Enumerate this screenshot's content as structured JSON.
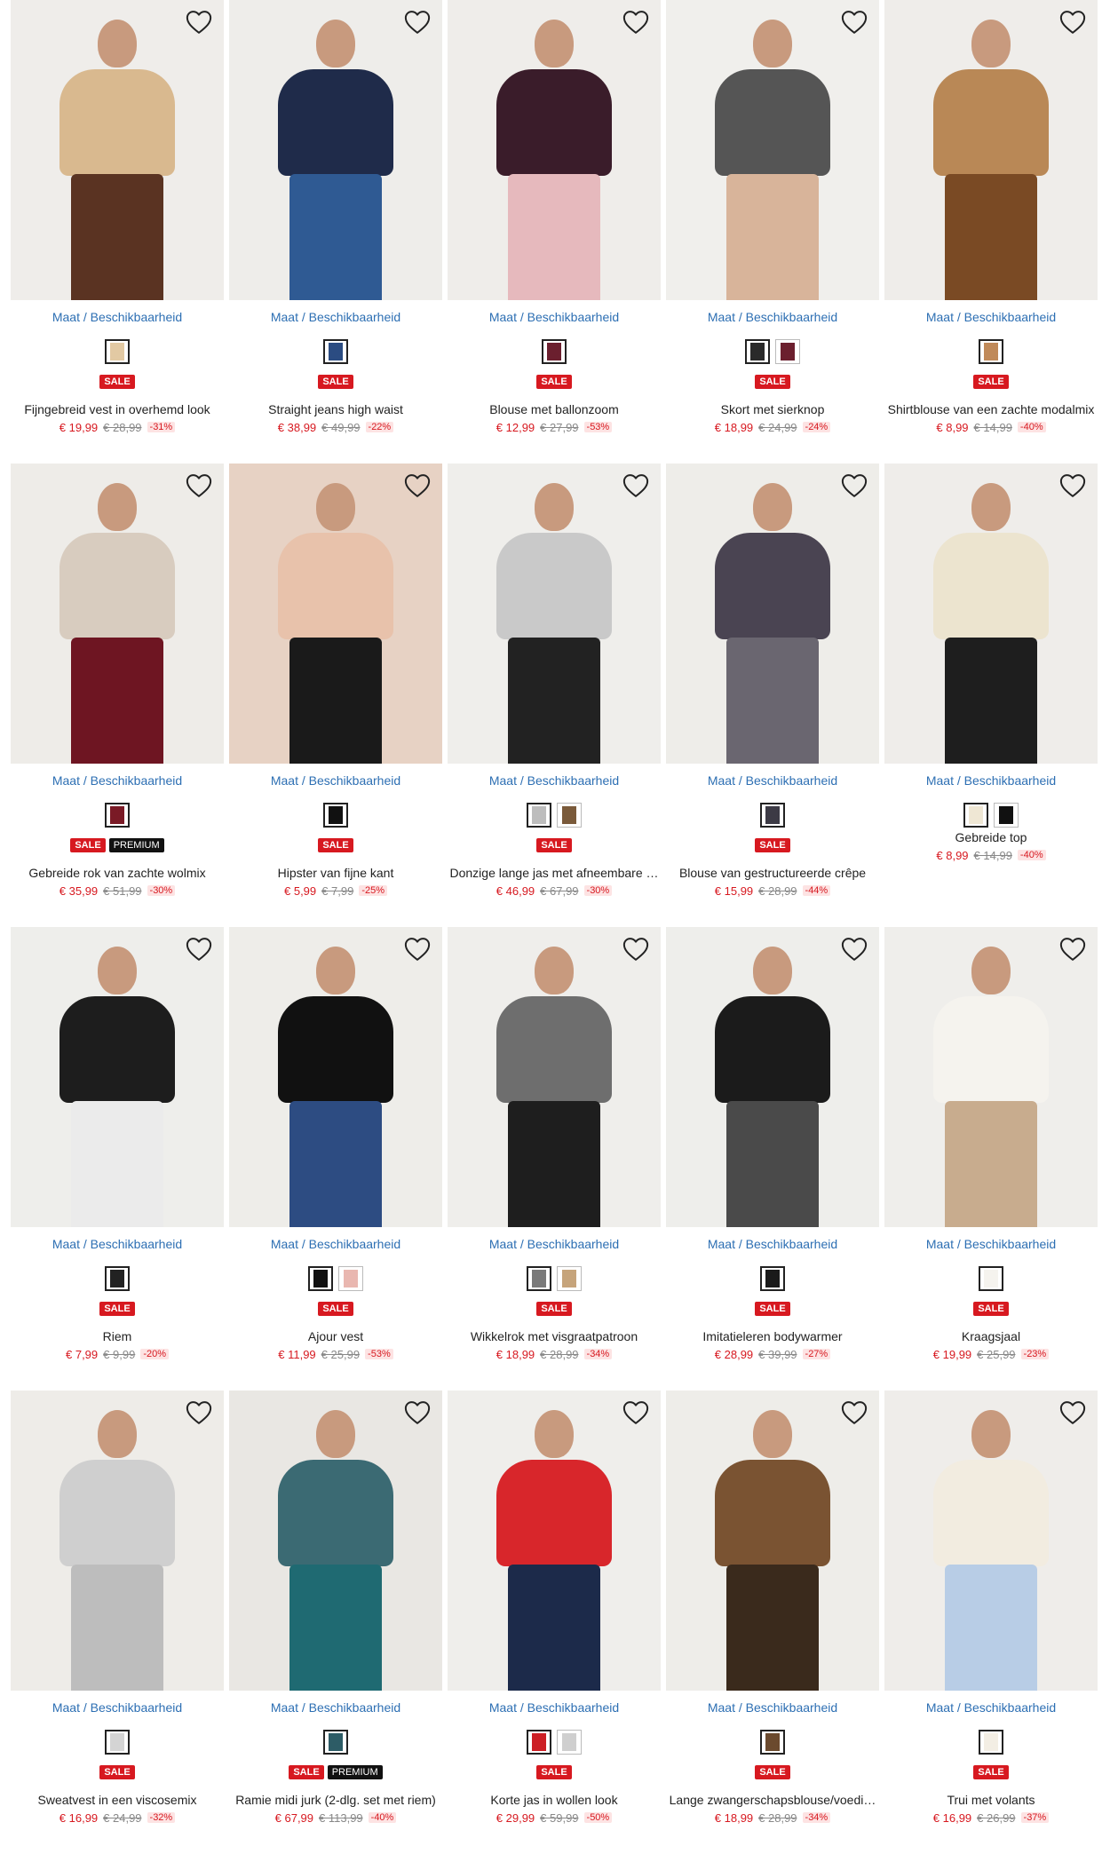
{
  "accent": "#d71920",
  "link_color": "#2d6fb3",
  "favorite_icon": "heart-outline-icon",
  "size_link_label": "Maat / Beschikbaarheid",
  "products": [
    {
      "name": "Fijngebreid vest in overhemd look",
      "price": "€ 19,99",
      "old_price": "€ 28,99",
      "discount": "-31%",
      "badges": [
        "SALE"
      ],
      "swatches": [
        "#e2c9a3"
      ],
      "image": {
        "bg": "#efedea",
        "top": "#d9b98f",
        "bottom": "#5a3322"
      }
    },
    {
      "name": "Straight jeans high waist",
      "price": "€ 38,99",
      "old_price": "€ 49,99",
      "discount": "-22%",
      "badges": [
        "SALE"
      ],
      "swatches": [
        "#2b4c82"
      ],
      "image": {
        "bg": "#eeedea",
        "top": "#1f2b4a",
        "bottom": "#2f5a93"
      }
    },
    {
      "name": "Blouse met ballonzoom",
      "price": "€ 12,99",
      "old_price": "€ 27,99",
      "discount": "-53%",
      "badges": [
        "SALE"
      ],
      "swatches": [
        "#6b1f2e"
      ],
      "image": {
        "bg": "#efedea",
        "top": "#3a1c2a",
        "bottom": "#e6b9bd"
      }
    },
    {
      "name": "Skort met sierknop",
      "price": "€ 18,99",
      "old_price": "€ 24,99",
      "discount": "-24%",
      "badges": [
        "SALE"
      ],
      "swatches": [
        "#2a2a2a",
        "#6b1f2e"
      ],
      "image": {
        "bg": "#f0efec",
        "top": "#555555",
        "bottom": "#d8b49a"
      }
    },
    {
      "name": "Shirtblouse van een zachte modalmix",
      "price": "€ 8,99",
      "old_price": "€ 14,99",
      "discount": "-40%",
      "badges": [
        "SALE"
      ],
      "swatches": [
        "#c08a5a"
      ],
      "image": {
        "bg": "#efedea",
        "top": "#b98856",
        "bottom": "#7a4a24"
      }
    },
    {
      "name": "Gebreide rok van zachte wolmix",
      "price": "€ 35,99",
      "old_price": "€ 51,99",
      "discount": "-30%",
      "badges": [
        "SALE",
        "PREMIUM"
      ],
      "swatches": [
        "#7a1a26"
      ],
      "image": {
        "bg": "#eeece8",
        "top": "#d8ccbf",
        "bottom": "#6e1522"
      }
    },
    {
      "name": "Hipster van fijne kant",
      "price": "€ 5,99",
      "old_price": "€ 7,99",
      "discount": "-25%",
      "badges": [
        "SALE"
      ],
      "swatches": [
        "#111111"
      ],
      "image": {
        "bg": "#e7d2c4",
        "top": "#e8c2ab",
        "bottom": "#1a1a1a"
      }
    },
    {
      "name": "Donzige lange jas met afneembare …",
      "price": "€ 46,99",
      "old_price": "€ 67,99",
      "discount": "-30%",
      "badges": [
        "SALE"
      ],
      "swatches": [
        "#bdbdbd",
        "#7a5a3a"
      ],
      "image": {
        "bg": "#efeeeb",
        "top": "#c9c9c9",
        "bottom": "#222222"
      }
    },
    {
      "name": "Blouse van gestructureerde crêpe",
      "price": "€ 15,99",
      "old_price": "€ 28,99",
      "discount": "-44%",
      "badges": [
        "SALE"
      ],
      "swatches": [
        "#3c3a45"
      ],
      "image": {
        "bg": "#eeede9",
        "top": "#4a4452",
        "bottom": "#6a6670"
      }
    },
    {
      "name": "Gebreide top",
      "price": "€ 8,99",
      "old_price": "€ 14,99",
      "discount": "-40%",
      "badges": [],
      "swatches": [
        "#efe7d4",
        "#111111"
      ],
      "image": {
        "bg": "#efedea",
        "top": "#ece4cf",
        "bottom": "#1e1e1e"
      }
    },
    {
      "name": "Riem",
      "price": "€ 7,99",
      "old_price": "€ 9,99",
      "discount": "-20%",
      "badges": [
        "SALE"
      ],
      "swatches": [
        "#222222"
      ],
      "image": {
        "bg": "#eeeeeb",
        "top": "#1d1d1d",
        "bottom": "#ebebeb"
      }
    },
    {
      "name": "Ajour vest",
      "price": "€ 11,99",
      "old_price": "€ 25,99",
      "discount": "-53%",
      "badges": [
        "SALE"
      ],
      "swatches": [
        "#111111",
        "#e9b7b0"
      ],
      "image": {
        "bg": "#eeede9",
        "top": "#111111",
        "bottom": "#2d4c82"
      }
    },
    {
      "name": "Wikkelrok met visgraatpatroon",
      "price": "€ 18,99",
      "old_price": "€ 28,99",
      "discount": "-34%",
      "badges": [
        "SALE"
      ],
      "swatches": [
        "#7a7a7a",
        "#c6a47b"
      ],
      "image": {
        "bg": "#efeeeb",
        "top": "#6e6e6e",
        "bottom": "#1e1e1e"
      }
    },
    {
      "name": "Imitatieleren bodywarmer",
      "price": "€ 28,99",
      "old_price": "€ 39,99",
      "discount": "-27%",
      "badges": [
        "SALE"
      ],
      "swatches": [
        "#1a1a1a"
      ],
      "image": {
        "bg": "#eeeeeb",
        "top": "#1b1b1b",
        "bottom": "#4a4a4a"
      }
    },
    {
      "name": "Kraagsjaal",
      "price": "€ 19,99",
      "old_price": "€ 25,99",
      "discount": "-23%",
      "badges": [
        "SALE"
      ],
      "swatches": [
        "#f5f3ee"
      ],
      "image": {
        "bg": "#efeeeb",
        "top": "#f5f3ee",
        "bottom": "#c8ac8e"
      }
    },
    {
      "name": "Sweatvest in een viscosemix",
      "price": "€ 16,99",
      "old_price": "€ 24,99",
      "discount": "-32%",
      "badges": [
        "SALE"
      ],
      "swatches": [
        "#d4d4d4"
      ],
      "image": {
        "bg": "#eeece8",
        "top": "#cfcfcf",
        "bottom": "#bdbdbd"
      }
    },
    {
      "name": "Ramie midi jurk (2-dlg. set met riem)",
      "price": "€ 67,99",
      "old_price": "€ 113,99",
      "discount": "-40%",
      "badges": [
        "SALE",
        "PREMIUM"
      ],
      "swatches": [
        "#2d5c66"
      ],
      "image": {
        "bg": "#e9e7e3",
        "top": "#3b6a73",
        "bottom": "#1f6a72"
      }
    },
    {
      "name": "Korte jas in wollen look",
      "price": "€ 29,99",
      "old_price": "€ 59,99",
      "discount": "-50%",
      "badges": [
        "SALE"
      ],
      "swatches": [
        "#cc1f25",
        "#cfcfcf"
      ],
      "image": {
        "bg": "#efeeeb",
        "top": "#d8262b",
        "bottom": "#1c2a4a"
      }
    },
    {
      "name": "Lange zwangerschapsblouse/voedi…",
      "price": "€ 18,99",
      "old_price": "€ 28,99",
      "discount": "-34%",
      "badges": [
        "SALE"
      ],
      "swatches": [
        "#6b4a2e"
      ],
      "image": {
        "bg": "#eeede9",
        "top": "#7a5332",
        "bottom": "#3a2a1c"
      }
    },
    {
      "name": "Trui met volants",
      "price": "€ 16,99",
      "old_price": "€ 26,99",
      "discount": "-37%",
      "badges": [
        "SALE"
      ],
      "swatches": [
        "#f3eee4"
      ],
      "image": {
        "bg": "#efedea",
        "top": "#f2ece0",
        "bottom": "#b8cde6"
      }
    }
  ]
}
